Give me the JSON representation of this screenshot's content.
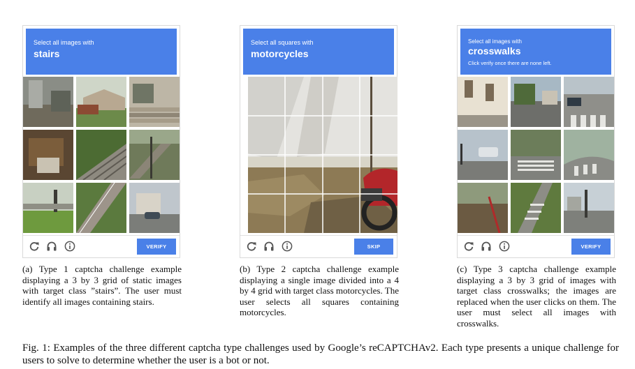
{
  "panels": [
    {
      "header": {
        "pre": "Select all images with",
        "target": "stairs",
        "note": ""
      },
      "button": "VERIFY",
      "caption": "(a) Type 1 captcha challenge example displaying a 3 by 3 grid of static images with target class ”stairs”. The user must identify all images containing stairs."
    },
    {
      "header": {
        "pre": "Select all squares with",
        "target": "motorcycles",
        "note": ""
      },
      "button": "SKIP",
      "caption": "(b) Type 2 captcha challenge example displaying a single image divided into a 4 by 4 grid with target class motorcycles. The user selects all squares containing motorcycles."
    },
    {
      "header": {
        "pre": "Select all images with",
        "target": "crosswalks",
        "note": "Click verify once there are none left."
      },
      "button": "VERIFY",
      "caption": "(c) Type 3 captcha challenge example displaying a 3 by 3 grid of images with target class crosswalks; the images are replaced when the user clicks on them. The user must select all images with crosswalks."
    }
  ],
  "icons": [
    "reload-icon",
    "headphones-icon",
    "info-icon"
  ],
  "colors": {
    "header_blue": "#4a80e8"
  },
  "figure_caption": "Fig. 1: Examples of the three different captcha type challenges used by Google’s reCAPTCHAv2. Each type presents a unique challenge for users to solve to determine whether the user is a bot or not."
}
